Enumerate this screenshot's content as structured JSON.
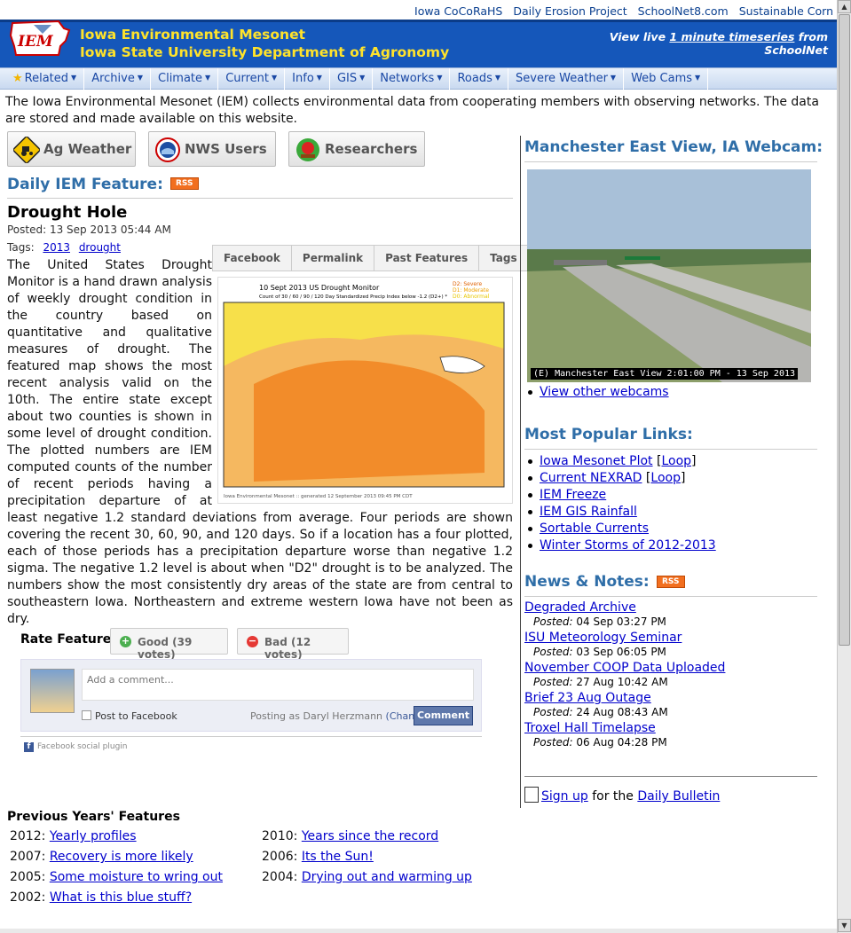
{
  "top_links": [
    "Iowa CoCoRaHS",
    "Daily Erosion Project",
    "SchoolNet8.com",
    "Sustainable Corn"
  ],
  "header": {
    "logo_text": "IEM",
    "title_line1": "Iowa Environmental Mesonet",
    "title_line2": "Iowa State University Department of Agronomy",
    "live_prefix": "View live",
    "live_link": "1 minute timeseries",
    "live_suffix": "from",
    "live_source": "SchoolNet"
  },
  "nav": [
    "Related",
    "Archive",
    "Climate",
    "Current",
    "Info",
    "GIS",
    "Networks",
    "Roads",
    "Severe Weather",
    "Web Cams"
  ],
  "intro": "The Iowa Environmental Mesonet (IEM) collects environmental data from cooperating members with observing networks. The data are stored and made available on this website.",
  "audiences": [
    "Ag Weather",
    "NWS Users",
    "Researchers"
  ],
  "feature": {
    "heading": "Daily IEM Feature:",
    "rss": "RSS",
    "title": "Drought Hole",
    "posted": "Posted: 13 Sep 2013 05:44 AM",
    "tags_label": "Tags:",
    "tags": [
      "2013",
      "drought"
    ],
    "tabs": [
      "Facebook",
      "Permalink",
      "Past Features",
      "Tags"
    ],
    "map_title": "10 Sept 2013 US Drought Monitor",
    "map_subtitle": "Count of 30 / 60 / 90 / 120 Day Standardized Precip Index below -1.2 (D2+) *",
    "map_legend": [
      "D2: Severe",
      "D1: Moderate",
      "D0: Abnormal"
    ],
    "map_footer": "Iowa Environmental Mesonet :: generated 12 September 2013 09:45 PM CDT",
    "body": "The United States Drought Monitor is a hand drawn analysis of weekly drought condition in the country based on quantitative and qualitative measures of drought. The featured map shows the most recent analysis valid on the 10th. The entire state except about two counties is shown in some level of drought condition. The plotted numbers are IEM computed counts of the number of recent periods having a precipitation departure of at least negative 1.2 standard deviations from average. Four periods are shown covering the recent 30, 60, 90, and 120 days. So if a location has a four plotted, each of those periods has a precipitation departure worse than negative 1.2 sigma. The negative 1.2 level is about when \"D2\" drought is to be analyzed. The numbers show the most consistently dry areas of the state are from central to southeastern Iowa. Northeastern and extreme western Iowa have not been as dry."
  },
  "rate": {
    "label": "Rate Feature",
    "good": "Good (39 votes)",
    "bad": "Bad (12 votes)"
  },
  "comment": {
    "placeholder": "Add a comment...",
    "post_to_fb": "Post to Facebook",
    "posting_as": "Posting as Daryl Herzmann",
    "change": "(Change)",
    "button": "Comment",
    "plugin": "Facebook social plugin"
  },
  "previous": {
    "heading": "Previous Years' Features",
    "items": [
      {
        "year": "2012:",
        "title": "Yearly profiles"
      },
      {
        "year": "2010:",
        "title": "Years since the record"
      },
      {
        "year": "2007:",
        "title": "Recovery is more likely"
      },
      {
        "year": "2006:",
        "title": "Its the Sun!"
      },
      {
        "year": "2005:",
        "title": "Some moisture to wring out"
      },
      {
        "year": "2004:",
        "title": "Drying out and warming up"
      },
      {
        "year": "2002:",
        "title": "What is this blue stuff?"
      }
    ]
  },
  "webcam": {
    "heading": "Manchester East View, IA Webcam:",
    "caption": "(E) Manchester East View  2:01:00 PM - 13 Sep 2013",
    "other": "View other webcams"
  },
  "popular": {
    "heading": "Most Popular Links:",
    "items": [
      {
        "label": "Iowa Mesonet Plot",
        "extra": "Loop"
      },
      {
        "label": "Current NEXRAD",
        "extra": "Loop"
      },
      {
        "label": "IEM Freeze",
        "extra": ""
      },
      {
        "label": "IEM GIS Rainfall",
        "extra": ""
      },
      {
        "label": "Sortable Currents",
        "extra": ""
      },
      {
        "label": "Winter Storms of 2012-2013",
        "extra": ""
      }
    ]
  },
  "news": {
    "heading": "News & Notes:",
    "rss": "RSS",
    "posted_label": "Posted:",
    "items": [
      {
        "title": "Degraded Archive",
        "date": "04 Sep 03:27 PM"
      },
      {
        "title": "ISU Meteorology Seminar",
        "date": "03 Sep 06:05 PM"
      },
      {
        "title": "November COOP Data Uploaded",
        "date": "27 Aug 10:42 AM"
      },
      {
        "title": "Brief 23 Aug Outage",
        "date": "24 Aug 08:43 AM"
      },
      {
        "title": "Troxel Hall Timelapse",
        "date": "06 Aug 04:28 PM"
      }
    ]
  },
  "signup": {
    "link": "Sign up",
    "middle": "for the",
    "bulletin": "Daily Bulletin"
  },
  "colors": {
    "header_blue": "#1557ba",
    "title_yellow": "#ffe32b",
    "heading_blue": "#2f6ea8",
    "rss_orange": "#f26f1f"
  }
}
